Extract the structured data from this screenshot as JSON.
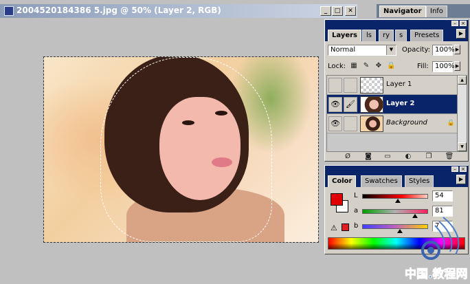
{
  "document": {
    "title": "2004520184386 5.jpg @ 50% (Layer 2, RGB)",
    "controls": {
      "minimize": "_",
      "maximize": "□",
      "close": "✕"
    }
  },
  "navigator": {
    "tabs": [
      "Navigator",
      "Info"
    ]
  },
  "layers": {
    "tabs": [
      "Layers",
      "ls",
      "ry",
      "s",
      "Presets"
    ],
    "blend_mode": "Normal",
    "opacity_label": "Opacity:",
    "opacity_value": "100%",
    "lock_label": "Lock:",
    "fill_label": "Fill:",
    "fill_value": "100%",
    "rows": [
      {
        "name": "Layer 1",
        "visible": false,
        "thumb": "transparent"
      },
      {
        "name": "Layer 2",
        "visible": true,
        "brush": true,
        "thumb": "girl",
        "selected": true
      },
      {
        "name": "Background",
        "visible": true,
        "thumb": "photo",
        "locked": true
      }
    ],
    "footer_icons": [
      "layer-style-icon",
      "mask-icon",
      "new-set-icon",
      "adjustment-icon",
      "new-layer-icon",
      "trash-icon"
    ]
  },
  "color": {
    "tabs": [
      "Color",
      "Swatches",
      "Styles"
    ],
    "foreground_color": "#e00000",
    "background_color": "#ffffff",
    "warning_swatch": "#e02020",
    "channels": [
      {
        "label": "L",
        "value": "54",
        "fraction": 0.54
      },
      {
        "label": "a",
        "value": "81",
        "fraction": 0.8
      },
      {
        "label": "b",
        "value": "7",
        "fraction": 0.57
      }
    ]
  },
  "watermark": {
    "text": "中国.教程网"
  }
}
